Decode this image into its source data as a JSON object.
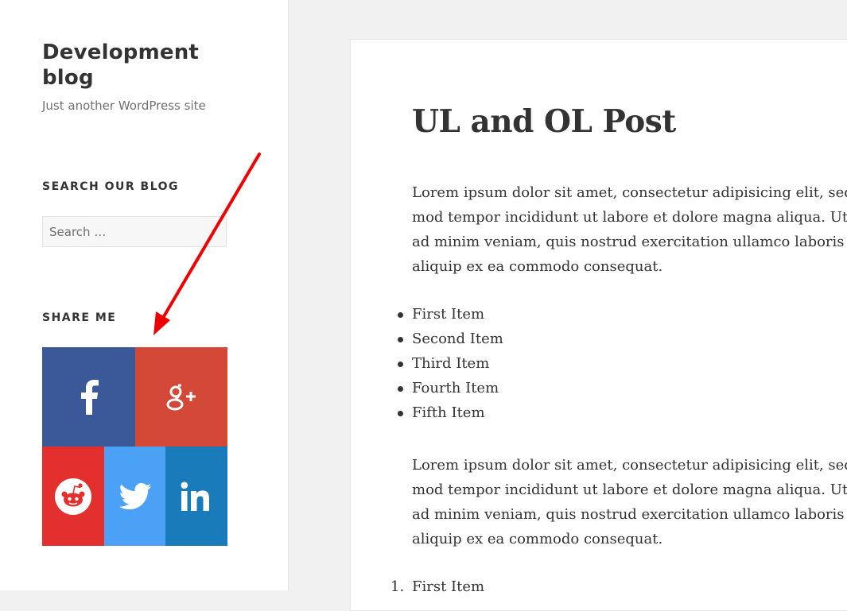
{
  "site": {
    "title": "Development blog",
    "description": "Just another WordPress site"
  },
  "search_widget": {
    "title": "SEARCH OUR BLOG",
    "placeholder": "Search …"
  },
  "share_widget": {
    "title": "SHARE ME",
    "buttons": [
      {
        "name": "facebook",
        "icon": "facebook-icon",
        "color": "#3b5998"
      },
      {
        "name": "google-plus",
        "icon": "google-plus-icon",
        "color": "#d34836"
      },
      {
        "name": "reddit",
        "icon": "reddit-icon",
        "color": "#e3302e"
      },
      {
        "name": "twitter",
        "icon": "twitter-icon",
        "color": "#4aa1f5"
      },
      {
        "name": "linkedin",
        "icon": "linkedin-icon",
        "color": "#1a7bbb"
      }
    ]
  },
  "annotation": {
    "color": "#ee0000"
  },
  "post": {
    "title": "UL and OL Post",
    "paragraph1": [
      "Lorem ipsum dolor sit amet, consectetur adipisicing elit, sed",
      "mod tempor incididunt ut labore et dolore magna aliqua. Ut",
      "ad minim veniam, quis nostrud exercitation ullamco laboris",
      "aliquip ex ea commodo consequat."
    ],
    "ul_items": [
      "First Item",
      "Second Item",
      "Third Item",
      "Fourth Item",
      "Fifth Item"
    ],
    "paragraph2": [
      "Lorem ipsum dolor sit amet, consectetur adipisicing elit, sed",
      "mod tempor incididunt ut labore et dolore magna aliqua. Ut",
      "ad minim veniam, quis nostrud exercitation ullamco laboris",
      "aliquip ex ea commodo consequat."
    ],
    "ol_items": [
      {
        "number": "1.",
        "label": "First Item"
      }
    ]
  }
}
